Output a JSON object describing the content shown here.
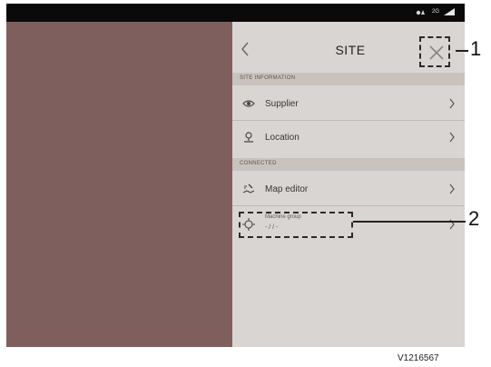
{
  "status_bar": {
    "network": "2G"
  },
  "header": {
    "title": "SITE"
  },
  "sections": {
    "site_information": "SITE INFORMATION",
    "connected": "CONNECTED"
  },
  "items": {
    "supplier": "Supplier",
    "location": "Location",
    "map_editor": "Map editor",
    "machine_group_label": "Machine group",
    "machine_group_value": "- / / -"
  },
  "callouts": {
    "close": "1",
    "machine_group": "2"
  },
  "figure_id": "V1216567",
  "colors": {
    "left_pane": "#7f5f5d",
    "right_pane": "#d9d5d2",
    "section_header": "#c9c3c0",
    "status_bar": "#0a0a0a"
  },
  "icons": {
    "back": "chevron-left-icon",
    "close": "close-icon",
    "supplier": "eye-icon",
    "location": "pin-icon",
    "map_editor": "map-edit-icon",
    "machine_group": "crosshair-icon",
    "row_chevron": "chevron-right-icon"
  }
}
